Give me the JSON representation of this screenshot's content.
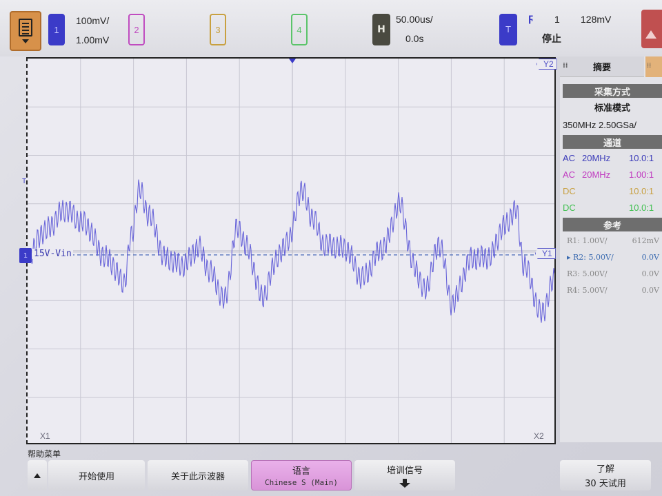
{
  "top_bar": {
    "ch1": {
      "number": "1",
      "scale": "100mV/",
      "offset": "1.00mV"
    },
    "ch2": {
      "number": "2"
    },
    "ch3": {
      "number": "3"
    },
    "ch4": {
      "number": "4"
    },
    "horizontal": {
      "badge": "H",
      "timebase": "50.00us/",
      "delay": "0.0s"
    },
    "trigger": {
      "badge": "T",
      "edge_symbol": "ϝ",
      "source": "1",
      "level": "128mV",
      "status": "停止"
    }
  },
  "scope": {
    "channel_label": "15V-Vin",
    "ref_marker": "1",
    "trigger_marker": "T",
    "markers": {
      "y1": "Y1",
      "y2": "Y2",
      "x1": "X1",
      "x2": "X2"
    },
    "trace_color": "#5a55d6"
  },
  "panel": {
    "tab": "摘要",
    "acquisition": {
      "header": "采集方式",
      "mode": "标准模式",
      "rate": "350MHz  2.50GSa/"
    },
    "channels": {
      "header": "通道",
      "rows": [
        {
          "coupling": "AC",
          "bw": "20MHz",
          "value": "10.0:1",
          "color": "#3a3ab8"
        },
        {
          "coupling": "AC",
          "bw": "20MHz",
          "value": "1.00:1",
          "color": "#c03ac0"
        },
        {
          "coupling": "DC",
          "bw": "",
          "value": "10.0:1",
          "color": "#c8a040"
        },
        {
          "coupling": "DC",
          "bw": "",
          "value": "10.0:1",
          "color": "#40c050"
        }
      ]
    },
    "reference": {
      "header": "参考",
      "rows": [
        {
          "name": "R1: 1.00V/",
          "value": "612mV"
        },
        {
          "name": "▸ R2: 5.00V/",
          "value": "0.0V",
          "selected": true
        },
        {
          "name": "R3: 5.00V/",
          "value": "0.0V"
        },
        {
          "name": "R4: 5.00V/",
          "value": "0.0V"
        }
      ]
    }
  },
  "softkeys": {
    "menu_title": "帮助菜单",
    "start": "开始使用",
    "about": "关于此示波器",
    "language": "语言",
    "language_value": "Chinese S (Main)",
    "training": "培训信号",
    "trial": "了解",
    "trial_sub": "30 天试用"
  }
}
